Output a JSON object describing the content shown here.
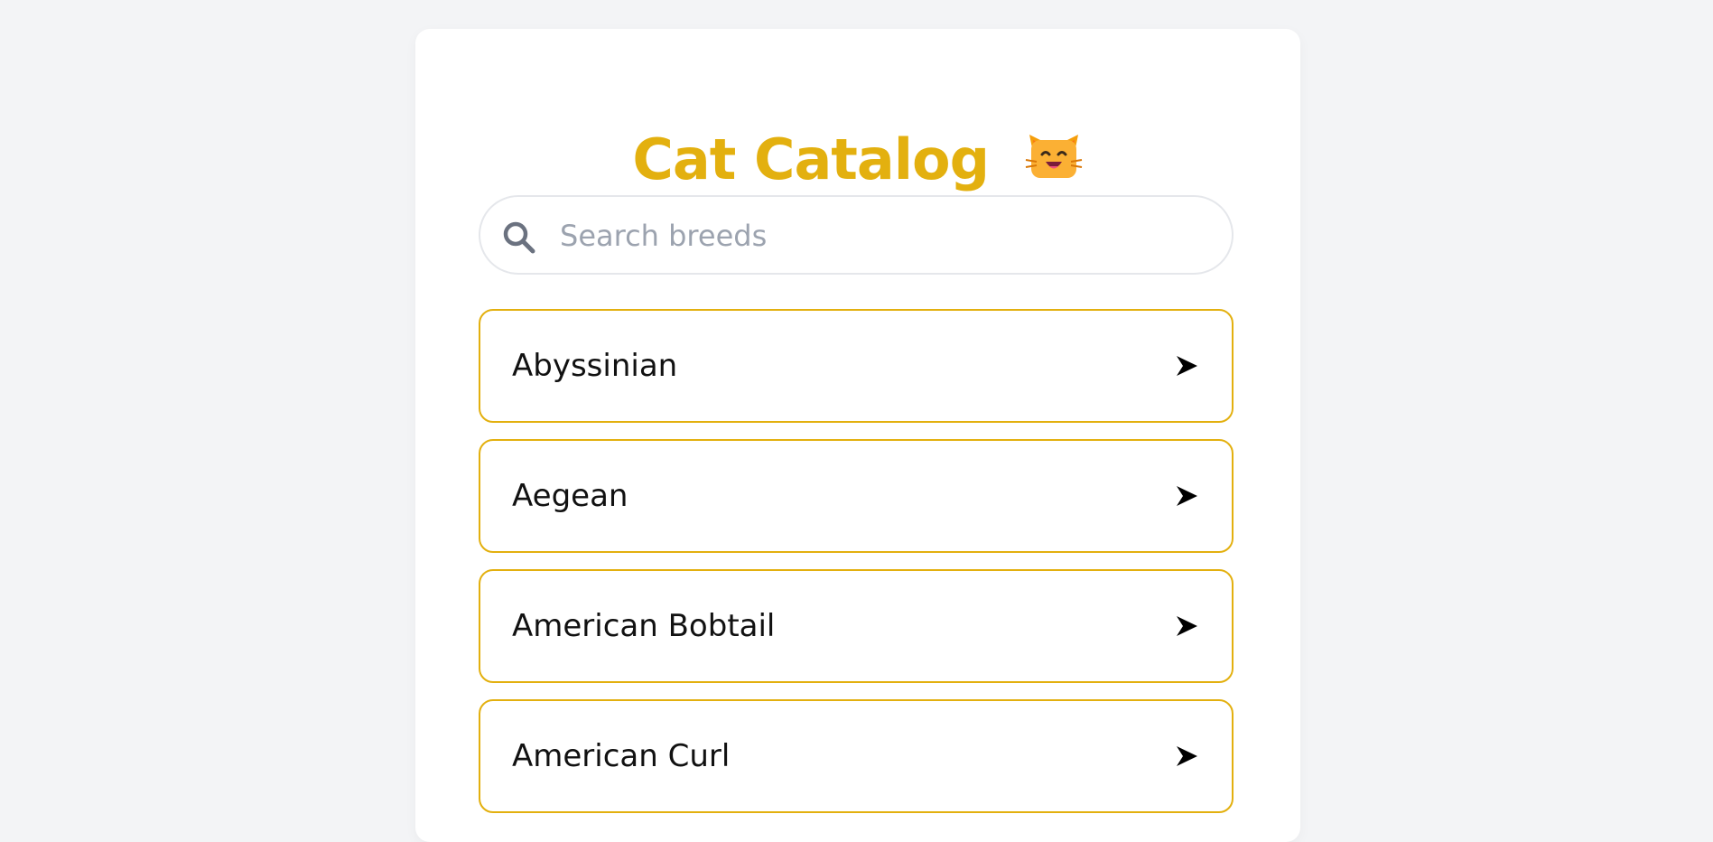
{
  "header": {
    "title": "Cat Catalog",
    "emoji_icon": "cat-face-icon"
  },
  "search": {
    "placeholder": "Search breeds",
    "value": "",
    "icon": "search-icon"
  },
  "breeds": [
    {
      "label": "Abyssinian",
      "icon": "arrow-right-icon"
    },
    {
      "label": "Aegean",
      "icon": "arrow-right-icon"
    },
    {
      "label": "American Bobtail",
      "icon": "arrow-right-icon"
    },
    {
      "label": "American Curl",
      "icon": "arrow-right-icon"
    }
  ],
  "colors": {
    "accent": "#e3b00f",
    "background": "#f3f4f6",
    "card": "#ffffff",
    "search_border": "#e5e7eb",
    "placeholder": "#9ca3af"
  }
}
